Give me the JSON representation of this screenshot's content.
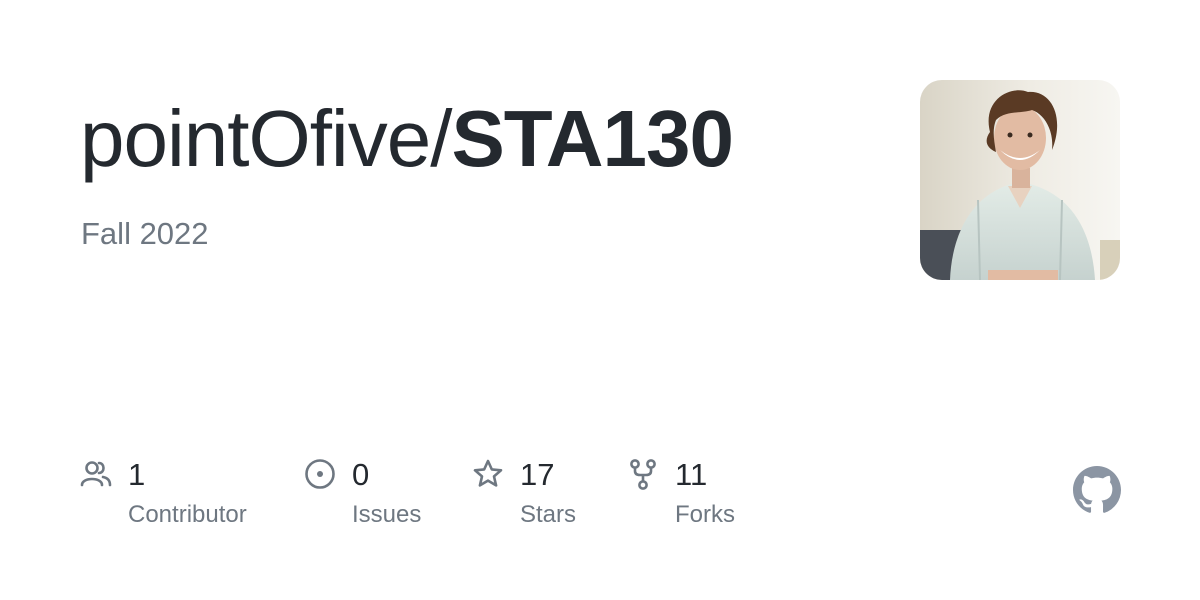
{
  "repo": {
    "owner": "pointOfive",
    "separator": "/",
    "name": "STA130",
    "description": "Fall 2022"
  },
  "avatar": {
    "icon": "user-avatar-photo"
  },
  "stats": {
    "contributors": {
      "value": "1",
      "label": "Contributor",
      "icon": "people-icon"
    },
    "issues": {
      "value": "0",
      "label": "Issues",
      "icon": "issue-opened-icon"
    },
    "stars": {
      "value": "17",
      "label": "Stars",
      "icon": "star-icon"
    },
    "forks": {
      "value": "11",
      "label": "Forks",
      "icon": "repo-forked-icon"
    }
  },
  "brand": {
    "logo": "github-mark-icon",
    "logo_color": "#8b95a3",
    "text_color": "#24292f",
    "muted_color": "#6e7781"
  }
}
